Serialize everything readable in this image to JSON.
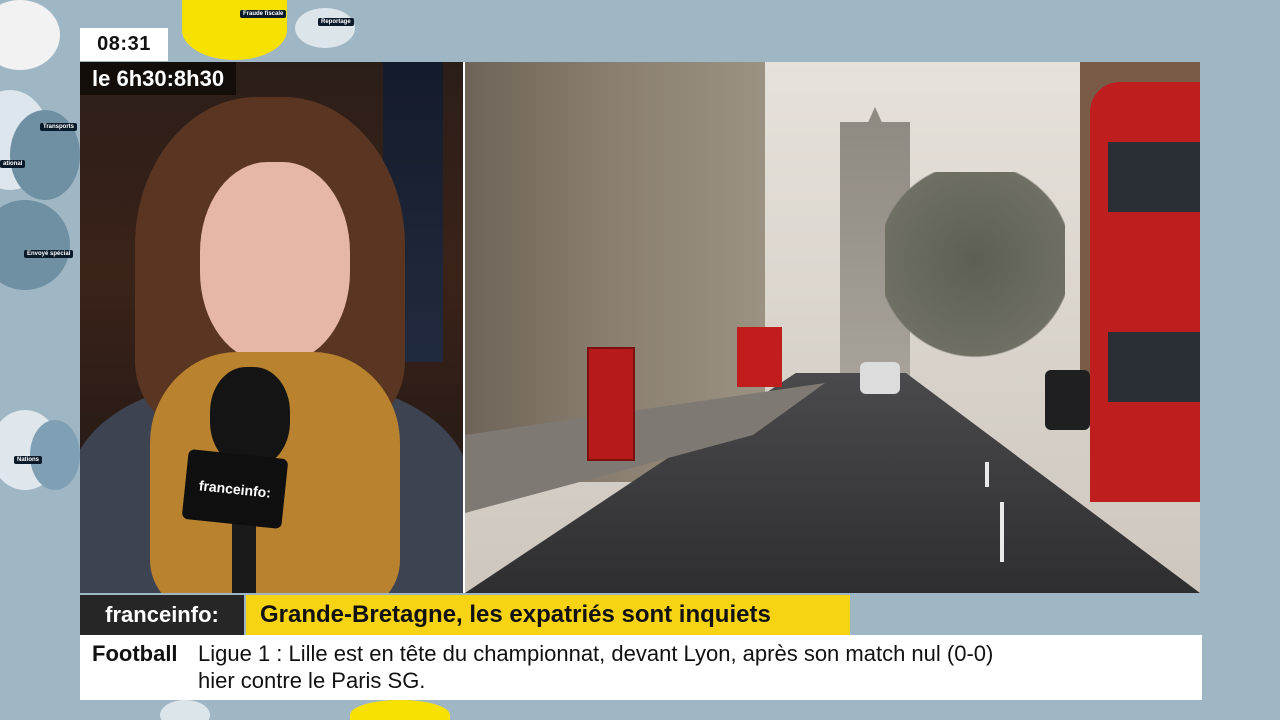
{
  "overlay": {
    "clock": "08:31",
    "show_time": "le 6h30:8h30"
  },
  "mic_flag": {
    "label": "franceinfo:"
  },
  "headline": {
    "brand": "franceinfo:",
    "title": "Grande-Bretagne, les expatriés sont inquiets"
  },
  "ticker": {
    "category": "Football",
    "line1": "Ligue 1 : Lille est en tête du championnat, devant Lyon, après son match nul (0-0)",
    "line2": "hier contre le Paris SG."
  },
  "bg_tags": [
    "Fraude fiscale",
    "Reportage",
    "Transports",
    "Envoyé spécial",
    "Nations",
    "ational"
  ],
  "colors": {
    "accent_yellow": "#f7d413",
    "brand_dark": "#262626",
    "background_blue": "#9fb6c5"
  }
}
